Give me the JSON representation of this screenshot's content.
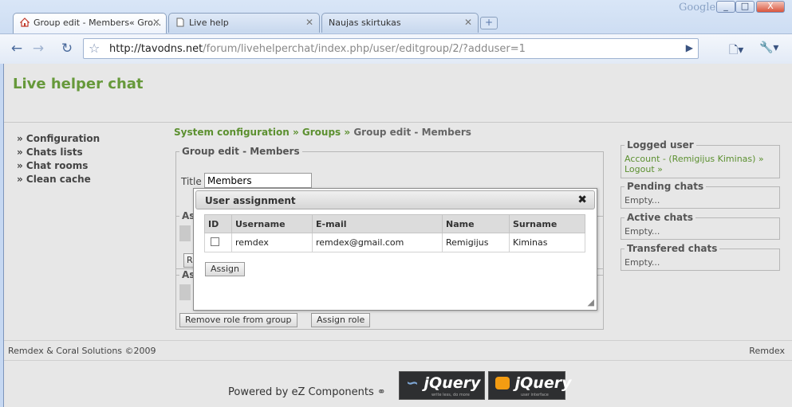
{
  "browser": {
    "tabs": [
      {
        "label": "Group edit - Members« Gro...",
        "active": true
      },
      {
        "label": "Live help",
        "active": false
      },
      {
        "label": "Naujas skirtukas",
        "active": false
      }
    ],
    "new_tab": "+",
    "brand": "Google",
    "window_buttons": [
      "_",
      "□",
      "X"
    ],
    "url_host": "http://tavodns.net",
    "url_path": "/forum/livehelperchat/index.php/user/editgroup/2/?adduser=1"
  },
  "site": {
    "title": "Live helper chat"
  },
  "left_nav": {
    "items": [
      "» Configuration",
      "» Chats lists",
      "» Chat rooms",
      "» Clean cache"
    ]
  },
  "breadcrumb": {
    "items": [
      "System configuration",
      "Groups",
      "Group edit - Members"
    ],
    "separator": "»"
  },
  "group_edit": {
    "legend": "Group edit - Members",
    "title_label": "Title",
    "title_value": "Members",
    "assigned_users_legend_partial": "As",
    "assigned_users_button_partial": "R",
    "assigned_roles_legend_partial": "As",
    "remove_role_button": "Remove role from group",
    "assign_role_button": "Assign role"
  },
  "dialog": {
    "title": "User assignment",
    "close": "✖",
    "columns": [
      "ID",
      "Username",
      "E-mail",
      "Name",
      "Surname"
    ],
    "rows": [
      {
        "username": "remdex",
        "email": "remdex@gmail.com",
        "name": "Remigijus",
        "surname": "Kiminas"
      }
    ],
    "assign_button": "Assign"
  },
  "right_panel": {
    "logged_user": {
      "title": "Logged user",
      "account_link": "Account - (Remigijus Kiminas) »",
      "logout_link": "Logout »"
    },
    "pending": {
      "title": "Pending chats",
      "text": "Empty..."
    },
    "active": {
      "title": "Active chats",
      "text": "Empty..."
    },
    "transfered": {
      "title": "Transfered chats",
      "text": "Empty..."
    }
  },
  "footer": {
    "copyright": "Remdex & Coral Solutions ©2009",
    "right": "Remdex",
    "powered_by": "Powered by eZ Components",
    "jquery_badge_1": "jQuery",
    "jquery_badge_1_tagline": "write less, do more",
    "jquery_badge_2": "jQuery",
    "jquery_badge_2_tagline": "user interface"
  },
  "colors": {
    "brand_green": "#66993a",
    "link_green": "#5c9030",
    "page_bg": "#e7e7e7"
  }
}
